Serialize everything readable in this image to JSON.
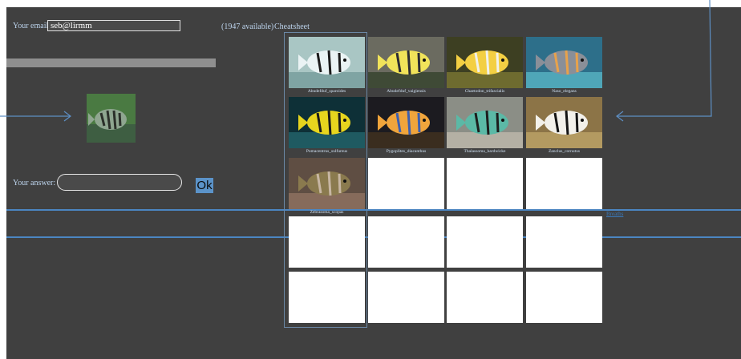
{
  "email": {
    "label": "Your email:",
    "value": "seb@lirmm"
  },
  "header": {
    "available": "(1947 available)",
    "cheatsheet": "Cheatsheet"
  },
  "progress": {
    "fraction": 1.0
  },
  "answer": {
    "label": "Your answer:",
    "value": ""
  },
  "ok_label": "Ok",
  "partial_link": "Breaths",
  "gallery": [
    {
      "caption": "Abudefduf_sparoides",
      "colors": [
        "#a9c6c4",
        "#7fa4a3",
        "#eaf3f4",
        "#1b1b1b"
      ]
    },
    {
      "caption": "Abudefduf_vaigiensis",
      "colors": [
        "#6b6b60",
        "#3f4a36",
        "#f1e35a",
        "#2c2c34"
      ]
    },
    {
      "caption": "Chaetodon_trifascialis",
      "colors": [
        "#3d3f22",
        "#6e6b2f",
        "#f3cf43",
        "#f1f1ea"
      ]
    },
    {
      "caption": "Naso_elegans",
      "colors": [
        "#2d6f8a",
        "#4fa6b8",
        "#8a8f98",
        "#e7a24b"
      ]
    },
    {
      "caption": "Pomacentrus_sulfureus",
      "colors": [
        "#0e3037",
        "#1f5a61",
        "#e7d51e",
        "#1a1a1a"
      ]
    },
    {
      "caption": "Pygoplites_diacanthus",
      "colors": [
        "#1c1b20",
        "#3a2d1f",
        "#f0a53c",
        "#3d5fb0"
      ]
    },
    {
      "caption": "Thalassoma_hardwicke",
      "colors": [
        "#8b8e86",
        "#b4b0a4",
        "#5bb9a6",
        "#1d1d1d"
      ]
    },
    {
      "caption": "Zanclus_cornutus",
      "colors": [
        "#8c7447",
        "#b39a61",
        "#f2f0ea",
        "#141414"
      ]
    },
    {
      "caption": "Zebrasoma_scopas",
      "colors": [
        "#5f4e43",
        "#866b5b",
        "#8a7a4e",
        "#c7b6a3"
      ]
    }
  ],
  "query_image": {
    "colors": [
      "#4a7a42",
      "#3e5e42",
      "#8fa690",
      "#2b2f29"
    ]
  },
  "accent": "#4b86c2"
}
